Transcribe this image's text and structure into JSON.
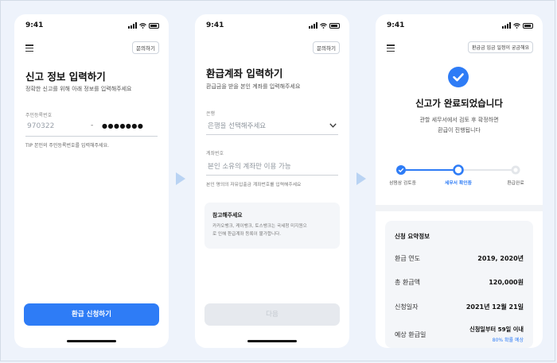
{
  "status_time": "9:41",
  "screen1": {
    "inquiry": "문의하기",
    "title": "신고 정보 입력하기",
    "subtitle": "정확한 신고를 위해 아래 정보를 입력해주세요",
    "field_label": "주민등록번호",
    "id_front": "970322",
    "id_dash": "-",
    "id_back": "●●●●●●●",
    "tip": "TIP 본인의 주민등록번호를 입력해주세요.",
    "cta": "환급 신청하기"
  },
  "screen2": {
    "inquiry": "문의하기",
    "title": "환급계좌 입력하기",
    "subtitle": "환급금을 받을 본인 계좌를 입력해주세요",
    "bank_label": "은행",
    "bank_placeholder": "은행을 선택해주세요",
    "account_label": "계좌번호",
    "account_placeholder": "본인 소유의 계좌만 이용 가능",
    "account_hint": "본인 명의의 자유입출금 계좌번호를 입력해주세요",
    "notice_title": "참고해주세요",
    "notice_body_1": "카카오뱅크, 케이뱅크, 토스뱅크는 국세청 미지원으",
    "notice_body_2": "로 인해 환급계좌 등록이 불가합니다.",
    "cta": "다음"
  },
  "screen3": {
    "inquiry": "환급금 입금 일정이 궁금해요",
    "title": "신고가 완료되었습니다",
    "desc_1": "관할 세무서에서 검토 후 확정하면",
    "desc_2": "환급이 진행됩니다",
    "steps": [
      "삼쩜삼 검토중",
      "세무서 확인중",
      "환급완료"
    ],
    "summary_title": "신청 요약정보",
    "rows": [
      {
        "label": "환급 연도",
        "value": "2019, 2020년"
      },
      {
        "label": "총 환급액",
        "value": "120,000원"
      },
      {
        "label": "신청일자",
        "value": "2021년 12월 21일"
      },
      {
        "label": "예상 환급일",
        "value": "신청일부터 59일 이내",
        "note": "80% 확률 예상"
      }
    ]
  },
  "colors": {
    "primary": "#2e7cf6",
    "disabled": "#e6e9ee",
    "panel": "#f4f6f9"
  }
}
